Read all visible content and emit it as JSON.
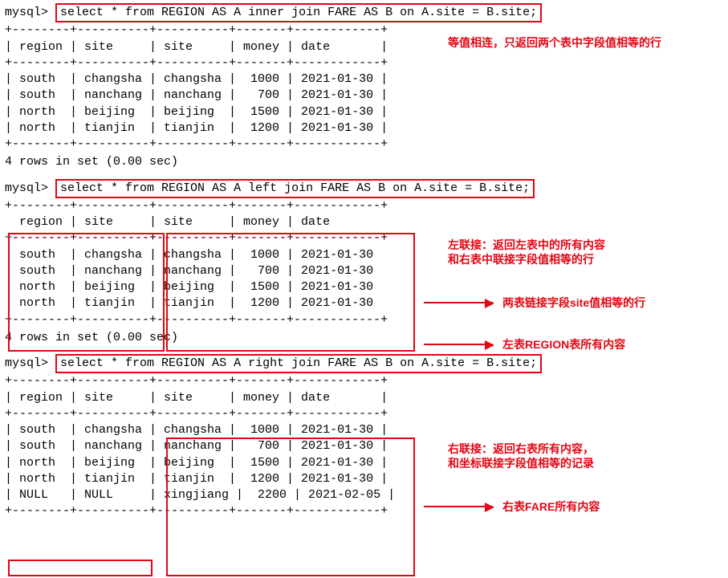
{
  "prompt": "mysql>",
  "queries": {
    "inner": "select * from REGION AS A inner join FARE AS B on A.site = B.site;",
    "left": "select * from REGION AS A left join FARE AS B on A.site = B.site;",
    "right": "select * from REGION AS A right join FARE AS B on A.site = B.site;"
  },
  "columns": [
    "region",
    "site",
    "site",
    "money",
    "date"
  ],
  "table_rows_4": [
    [
      "south",
      "changsha",
      "changsha",
      "1000",
      "2021-01-30"
    ],
    [
      "south",
      "nanchang",
      "nanchang",
      "700",
      "2021-01-30"
    ],
    [
      "north",
      "beijing",
      "beijing",
      "1500",
      "2021-01-30"
    ],
    [
      "north",
      "tianjin",
      "tianjin",
      "1200",
      "2021-01-30"
    ]
  ],
  "table_rows_5": [
    [
      "south",
      "changsha",
      "changsha",
      "1000",
      "2021-01-30"
    ],
    [
      "south",
      "nanchang",
      "nanchang",
      "700",
      "2021-01-30"
    ],
    [
      "north",
      "beijing",
      "beijing",
      "1500",
      "2021-01-30"
    ],
    [
      "north",
      "tianjin",
      "tianjin",
      "1200",
      "2021-01-30"
    ],
    [
      "NULL",
      "NULL",
      "xingjiang",
      "2200",
      "2021-02-05"
    ]
  ],
  "left_no_pipes": true,
  "status4": "4 rows in set (0.00 sec)",
  "annotations": {
    "inner": "等值相连，只返回两个表中字段值相等的行",
    "left1": "左联接：返回左表中的所有内容",
    "left2": "和右表中联接字段值相等的行",
    "left_arrow1": "两表链接字段site值相等的行",
    "left_arrow2": "左表REGION表所有内容",
    "right1": "右联接：返回右表所有内容，",
    "right2": "和坐标联接字段值相等的记录",
    "right_arrow": "右表FARE所有内容"
  }
}
